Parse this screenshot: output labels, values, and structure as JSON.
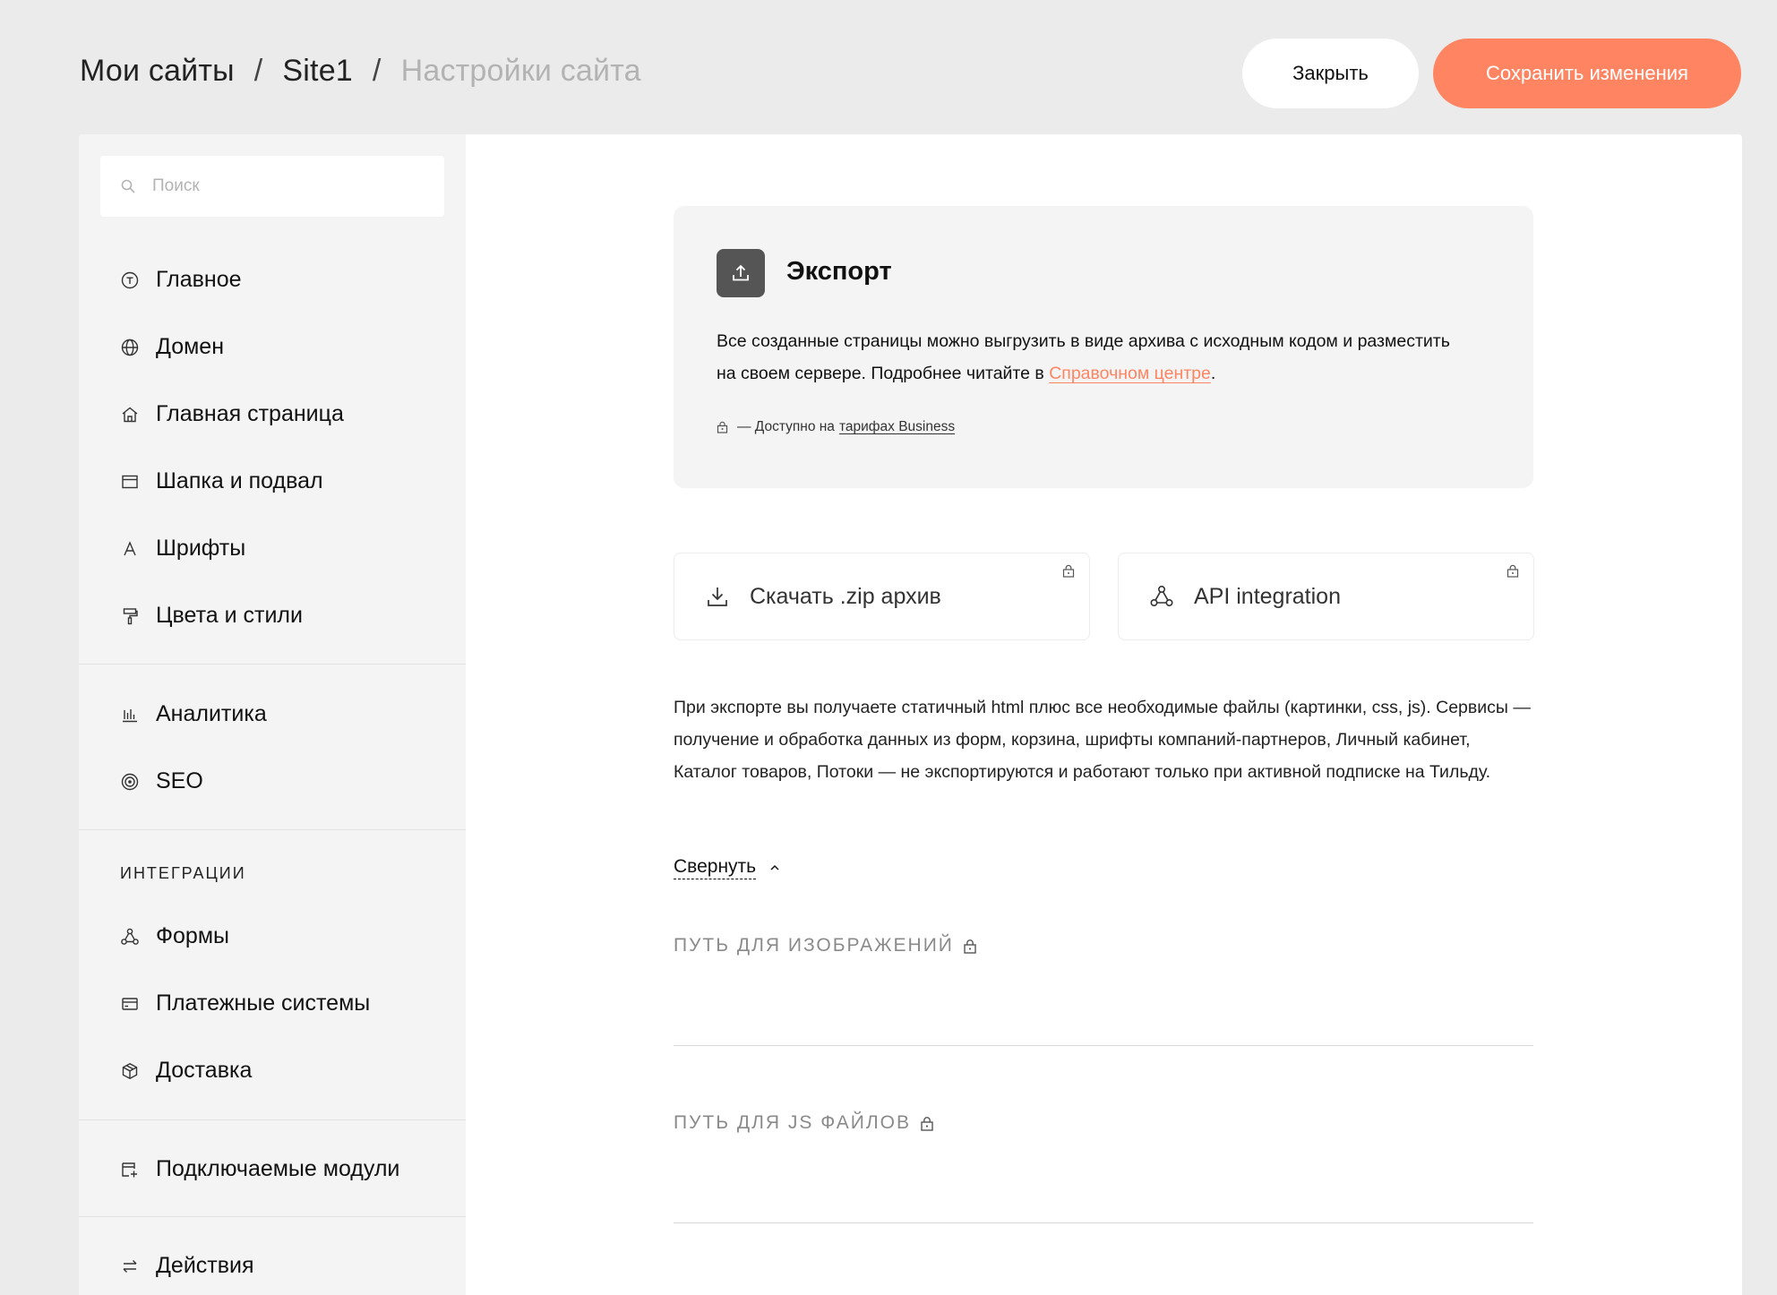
{
  "breadcrumb": {
    "items": [
      "Мои сайты",
      "Site1",
      "Настройки сайта"
    ],
    "separator": "/"
  },
  "header": {
    "close_label": "Закрыть",
    "save_label": "Сохранить изменения",
    "accent_color": "#ff8562"
  },
  "sidebar": {
    "search_placeholder": "Поиск",
    "items": [
      {
        "label": "Главное",
        "icon": "tilda-circle-icon"
      },
      {
        "label": "Домен",
        "icon": "globe-icon"
      },
      {
        "label": "Главная страница",
        "icon": "home-icon"
      },
      {
        "label": "Шапка и подвал",
        "icon": "layout-icon"
      },
      {
        "label": "Шрифты",
        "icon": "font-icon"
      },
      {
        "label": "Цвета и стили",
        "icon": "paint-roller-icon"
      },
      {
        "label": "Аналитика",
        "icon": "bar-chart-icon"
      },
      {
        "label": "SEO",
        "icon": "target-icon"
      },
      {
        "label": "Формы",
        "icon": "nodes-icon"
      },
      {
        "label": "Платежные системы",
        "icon": "credit-card-icon"
      },
      {
        "label": "Доставка",
        "icon": "box-icon"
      },
      {
        "label": "Подключаемые модули",
        "icon": "module-icon"
      },
      {
        "label": "Действия",
        "icon": "arrows-exchange-icon"
      }
    ],
    "section_integrations": "Интеграции"
  },
  "export": {
    "title": "Экспорт",
    "description_before": "Все созданные страницы можно выгрузить в виде архива с исходным кодом и разместить на своем сервере. Подробнее читайте в ",
    "help_link": "Справочном центре",
    "description_after": ".",
    "availability_prefix": "— Доступно на",
    "availability_link": "тарифах Business"
  },
  "options": {
    "zip_label": "Скачать .zip архив",
    "api_label": "API integration"
  },
  "info_text": "При экспорте вы получаете статичный html плюс все необходимые файлы (картинки, css, js). Сервисы — получение и обработка данных из форм, корзина, шрифты компаний-партнеров, Личный кабинет, Каталог товаров, Потоки — не экспортируются и работают только при активной подписке на Тильду.",
  "collapse_label": "Свернуть",
  "fields": {
    "images_path_label": "Путь для изображений",
    "js_path_label": "Путь для JS файлов"
  }
}
